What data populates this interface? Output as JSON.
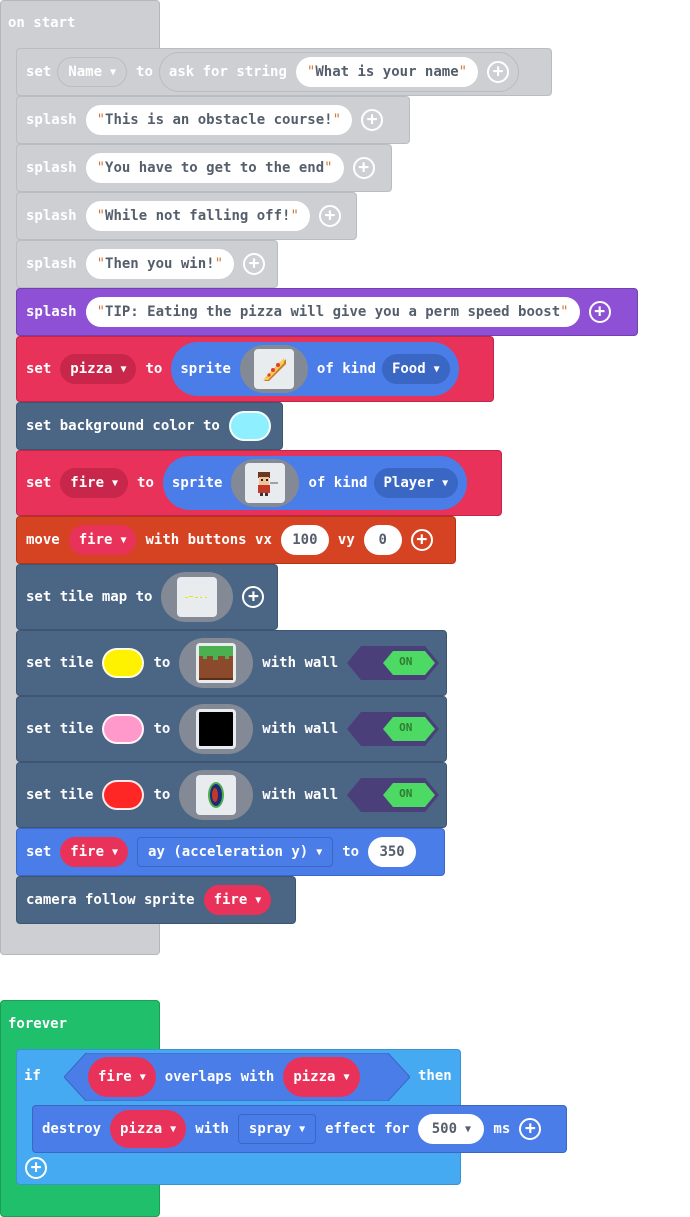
{
  "colors": {
    "gray_block": "#cecfd2",
    "purple_block": "#8e51d6",
    "sprite_block": "#e9325a",
    "scene_block": "#4b6584",
    "controller_block": "#d54322",
    "blue_block": "#4a7de8",
    "loop_block": "#20bf6b",
    "logic_block": "#45aaf2",
    "text_gray": "#b9bcc1"
  },
  "on_start": {
    "label": "on start",
    "set_name": {
      "set": "set",
      "var": "Name",
      "to": "to",
      "ask": "ask for string",
      "prompt": "What is your name"
    },
    "splash_items": [
      {
        "label": "splash",
        "text": "This is an obstacle course! "
      },
      {
        "label": "splash",
        "text": "You have to get to the end"
      },
      {
        "label": "splash",
        "text": "While not falling off!"
      },
      {
        "label": "splash",
        "text": "Then you win!"
      }
    ],
    "tip": {
      "label": "splash",
      "text": "TIP: Eating the pizza will give you a perm speed boost"
    },
    "set_pizza": {
      "set": "set",
      "var": "pizza",
      "to": "to",
      "sprite": "sprite",
      "of_kind": "of kind",
      "kind": "Food"
    },
    "bg_color": {
      "label": "set background color to",
      "color": "#8ef0ff"
    },
    "set_fire": {
      "set": "set",
      "var": "fire",
      "to": "to",
      "sprite": "sprite",
      "of_kind": "of kind",
      "kind": "Player"
    },
    "move": {
      "move": "move",
      "var": "fire",
      "with": "with buttons vx",
      "vx": "100",
      "vy_label": "vy",
      "vy": "0"
    },
    "tilemap": {
      "label": "set tile map to"
    },
    "tiles": [
      {
        "set": "set tile",
        "color": "#fff200",
        "to": "to",
        "with_wall": "with wall",
        "toggle": "ON",
        "image": "grass"
      },
      {
        "set": "set tile",
        "color": "#ff99cc",
        "to": "to",
        "with_wall": "with wall",
        "toggle": "ON",
        "image": "black"
      },
      {
        "set": "set tile",
        "color": "#ff2626",
        "to": "to",
        "with_wall": "with wall",
        "toggle": "ON",
        "image": "portal"
      }
    ],
    "accel": {
      "set": "set",
      "var": "fire",
      "prop": "ay (acceleration y)",
      "to": "to",
      "value": "350"
    },
    "camera": {
      "label": "camera follow sprite",
      "var": "fire"
    }
  },
  "forever": {
    "label": "forever",
    "if_label": "if",
    "cond_a": "fire",
    "overlaps": "overlaps with",
    "cond_b": "pizza",
    "then": "then",
    "destroy": {
      "label": "destroy",
      "var": "pizza",
      "with": "with",
      "effect": "spray",
      "effect_for": "effect for",
      "ms_value": "500",
      "ms": "ms"
    }
  }
}
